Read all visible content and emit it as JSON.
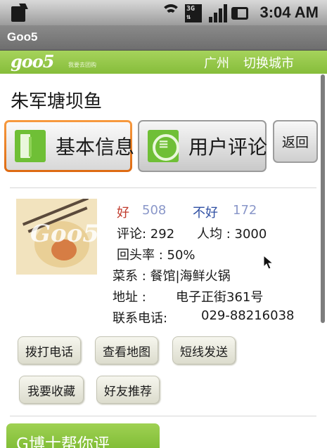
{
  "status_bar": {
    "time": "3:04 AM",
    "icons": [
      "sim-icon",
      "wifi-icon",
      "network-3g-icon",
      "signal-icon",
      "battery-icon"
    ]
  },
  "window": {
    "title": "Goo5"
  },
  "header": {
    "logo_text": "goo5",
    "slogan": "我要去团购",
    "city": "广州",
    "switch_city": "切换城市",
    "color": "#8fc43e"
  },
  "shop": {
    "name": "朱军塘坝鱼",
    "good_label": "好",
    "good_count": "508",
    "bad_label": "不好",
    "bad_count": "172",
    "comments": "评论: 292",
    "avg_price": "人均 : 3000",
    "return_rate": "回头率 : 50%",
    "cuisine": "菜系 : 餐馆|海鲜火锅",
    "address_label": "地址 :",
    "address": "电子正街361号",
    "phone_label": "联系电话:",
    "phone": "029-88216038"
  },
  "tabs": {
    "basic_info": "基本信息",
    "user_reviews": "用户评论",
    "active_color": "#ef7f1a"
  },
  "back_button": "返回",
  "actions": {
    "call": "拨打电话",
    "view_map": "查看地图",
    "send_sms": "短线发送",
    "favorite": "我要收藏",
    "recommend": "好友推荐"
  },
  "promo": {
    "label": "G博士帮你评"
  }
}
